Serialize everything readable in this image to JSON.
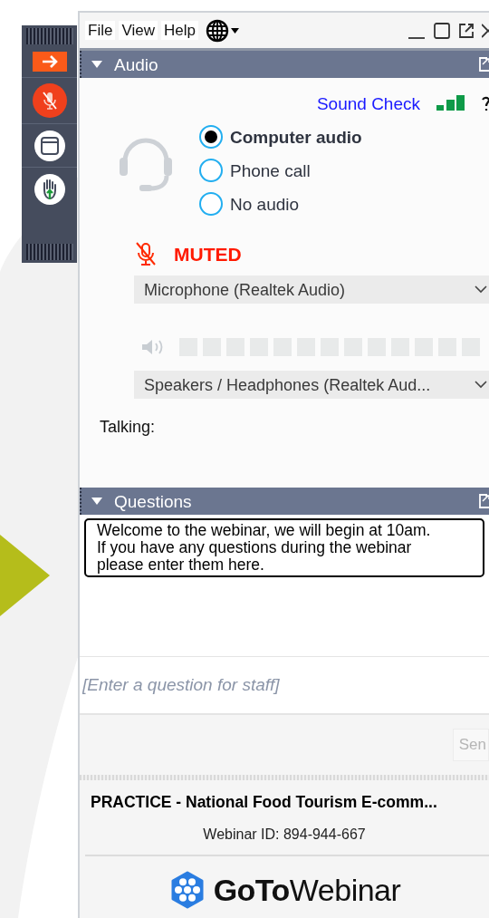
{
  "toolbar": {
    "mic_muted": true
  },
  "menu": [
    "File",
    "View",
    "Help"
  ],
  "audio": {
    "title": "Audio",
    "expanded": true,
    "sound_check": "Sound Check",
    "modes": [
      {
        "label": "Computer audio",
        "selected": true
      },
      {
        "label": "Phone call",
        "selected": false
      },
      {
        "label": "No audio",
        "selected": false
      }
    ],
    "muted": true,
    "muted_label": "MUTED",
    "microphone": "Microphone (Realtek Audio)",
    "speakers": "Speakers / Headphones (Realtek Aud...",
    "talking_label": "Talking:"
  },
  "questions": {
    "title": "Questions",
    "expanded": true,
    "messages": [
      "Welcome to the webinar, we will begin at 10am. If you have any questions during the webinar please enter them here."
    ],
    "input_placeholder": "[Enter a question for staff]",
    "send": "Sen"
  },
  "footer": {
    "webinar_title": "PRACTICE - National Food Tourism E-comm...",
    "webinar_id": "Webinar ID: 894-944-667",
    "brand": "**GoTo**Webinar"
  }
}
